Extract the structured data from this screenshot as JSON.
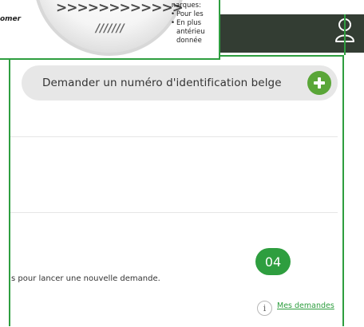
{
  "inset": {
    "left_text": "omer",
    "chevrons": ">>>>>>>>>>>>",
    "slashes": "///////",
    "remarks_title": ".narques:",
    "remarks_items": [
      "Pour les",
      "En plus",
      "antérieu",
      "donnée"
    ],
    "bullet": "•"
  },
  "header": {
    "user_icon": "user-icon"
  },
  "main": {
    "request_button_label": "Demander un numéro d'identification belge",
    "plus_icon": "plus-icon",
    "instruction_text": "s pour lancer une nouvelle demande.",
    "step_badge": "04",
    "info_icon_glyph": "i",
    "my_requests_link": "Mes demandes"
  },
  "colors": {
    "header_bg": "#333d33",
    "accent_green": "#2e9e3f",
    "plus_green": "#5aa638",
    "button_bg": "#e7e7e7"
  }
}
